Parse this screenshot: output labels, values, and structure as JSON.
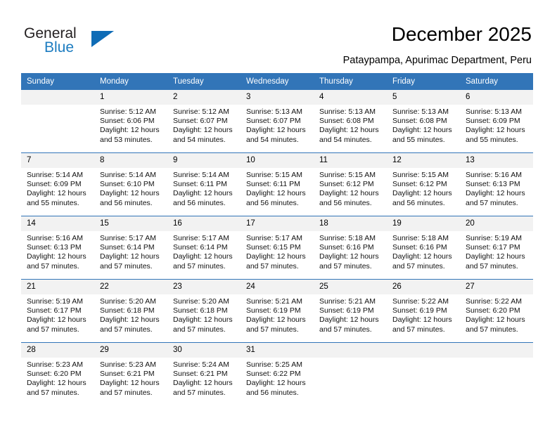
{
  "brand": {
    "line1": "General",
    "line2": "Blue",
    "triangle_icon": "brand-triangle-icon",
    "accent_color": "#0f6cb6"
  },
  "header": {
    "title": "December 2025",
    "subtitle": "Pataypampa, Apurimac Department, Peru"
  },
  "theme": {
    "header_blue": "#3275b8",
    "date_band_gray": "#f2f2f2",
    "rule_blue": "#3275b8",
    "text_black": "#000000"
  },
  "weekday_headers": [
    "Sunday",
    "Monday",
    "Tuesday",
    "Wednesday",
    "Thursday",
    "Friday",
    "Saturday"
  ],
  "weeks": [
    {
      "days": [
        {
          "date": "",
          "empty": true,
          "sunrise": "",
          "sunset": "",
          "daylight1": "",
          "daylight2": ""
        },
        {
          "date": "1",
          "empty": false,
          "sunrise": "Sunrise: 5:12 AM",
          "sunset": "Sunset: 6:06 PM",
          "daylight1": "Daylight: 12 hours",
          "daylight2": "and 53 minutes."
        },
        {
          "date": "2",
          "empty": false,
          "sunrise": "Sunrise: 5:12 AM",
          "sunset": "Sunset: 6:07 PM",
          "daylight1": "Daylight: 12 hours",
          "daylight2": "and 54 minutes."
        },
        {
          "date": "3",
          "empty": false,
          "sunrise": "Sunrise: 5:13 AM",
          "sunset": "Sunset: 6:07 PM",
          "daylight1": "Daylight: 12 hours",
          "daylight2": "and 54 minutes."
        },
        {
          "date": "4",
          "empty": false,
          "sunrise": "Sunrise: 5:13 AM",
          "sunset": "Sunset: 6:08 PM",
          "daylight1": "Daylight: 12 hours",
          "daylight2": "and 54 minutes."
        },
        {
          "date": "5",
          "empty": false,
          "sunrise": "Sunrise: 5:13 AM",
          "sunset": "Sunset: 6:08 PM",
          "daylight1": "Daylight: 12 hours",
          "daylight2": "and 55 minutes."
        },
        {
          "date": "6",
          "empty": false,
          "sunrise": "Sunrise: 5:13 AM",
          "sunset": "Sunset: 6:09 PM",
          "daylight1": "Daylight: 12 hours",
          "daylight2": "and 55 minutes."
        }
      ]
    },
    {
      "days": [
        {
          "date": "7",
          "empty": false,
          "sunrise": "Sunrise: 5:14 AM",
          "sunset": "Sunset: 6:09 PM",
          "daylight1": "Daylight: 12 hours",
          "daylight2": "and 55 minutes."
        },
        {
          "date": "8",
          "empty": false,
          "sunrise": "Sunrise: 5:14 AM",
          "sunset": "Sunset: 6:10 PM",
          "daylight1": "Daylight: 12 hours",
          "daylight2": "and 56 minutes."
        },
        {
          "date": "9",
          "empty": false,
          "sunrise": "Sunrise: 5:14 AM",
          "sunset": "Sunset: 6:11 PM",
          "daylight1": "Daylight: 12 hours",
          "daylight2": "and 56 minutes."
        },
        {
          "date": "10",
          "empty": false,
          "sunrise": "Sunrise: 5:15 AM",
          "sunset": "Sunset: 6:11 PM",
          "daylight1": "Daylight: 12 hours",
          "daylight2": "and 56 minutes."
        },
        {
          "date": "11",
          "empty": false,
          "sunrise": "Sunrise: 5:15 AM",
          "sunset": "Sunset: 6:12 PM",
          "daylight1": "Daylight: 12 hours",
          "daylight2": "and 56 minutes."
        },
        {
          "date": "12",
          "empty": false,
          "sunrise": "Sunrise: 5:15 AM",
          "sunset": "Sunset: 6:12 PM",
          "daylight1": "Daylight: 12 hours",
          "daylight2": "and 56 minutes."
        },
        {
          "date": "13",
          "empty": false,
          "sunrise": "Sunrise: 5:16 AM",
          "sunset": "Sunset: 6:13 PM",
          "daylight1": "Daylight: 12 hours",
          "daylight2": "and 57 minutes."
        }
      ]
    },
    {
      "days": [
        {
          "date": "14",
          "empty": false,
          "sunrise": "Sunrise: 5:16 AM",
          "sunset": "Sunset: 6:13 PM",
          "daylight1": "Daylight: 12 hours",
          "daylight2": "and 57 minutes."
        },
        {
          "date": "15",
          "empty": false,
          "sunrise": "Sunrise: 5:17 AM",
          "sunset": "Sunset: 6:14 PM",
          "daylight1": "Daylight: 12 hours",
          "daylight2": "and 57 minutes."
        },
        {
          "date": "16",
          "empty": false,
          "sunrise": "Sunrise: 5:17 AM",
          "sunset": "Sunset: 6:14 PM",
          "daylight1": "Daylight: 12 hours",
          "daylight2": "and 57 minutes."
        },
        {
          "date": "17",
          "empty": false,
          "sunrise": "Sunrise: 5:17 AM",
          "sunset": "Sunset: 6:15 PM",
          "daylight1": "Daylight: 12 hours",
          "daylight2": "and 57 minutes."
        },
        {
          "date": "18",
          "empty": false,
          "sunrise": "Sunrise: 5:18 AM",
          "sunset": "Sunset: 6:16 PM",
          "daylight1": "Daylight: 12 hours",
          "daylight2": "and 57 minutes."
        },
        {
          "date": "19",
          "empty": false,
          "sunrise": "Sunrise: 5:18 AM",
          "sunset": "Sunset: 6:16 PM",
          "daylight1": "Daylight: 12 hours",
          "daylight2": "and 57 minutes."
        },
        {
          "date": "20",
          "empty": false,
          "sunrise": "Sunrise: 5:19 AM",
          "sunset": "Sunset: 6:17 PM",
          "daylight1": "Daylight: 12 hours",
          "daylight2": "and 57 minutes."
        }
      ]
    },
    {
      "days": [
        {
          "date": "21",
          "empty": false,
          "sunrise": "Sunrise: 5:19 AM",
          "sunset": "Sunset: 6:17 PM",
          "daylight1": "Daylight: 12 hours",
          "daylight2": "and 57 minutes."
        },
        {
          "date": "22",
          "empty": false,
          "sunrise": "Sunrise: 5:20 AM",
          "sunset": "Sunset: 6:18 PM",
          "daylight1": "Daylight: 12 hours",
          "daylight2": "and 57 minutes."
        },
        {
          "date": "23",
          "empty": false,
          "sunrise": "Sunrise: 5:20 AM",
          "sunset": "Sunset: 6:18 PM",
          "daylight1": "Daylight: 12 hours",
          "daylight2": "and 57 minutes."
        },
        {
          "date": "24",
          "empty": false,
          "sunrise": "Sunrise: 5:21 AM",
          "sunset": "Sunset: 6:19 PM",
          "daylight1": "Daylight: 12 hours",
          "daylight2": "and 57 minutes."
        },
        {
          "date": "25",
          "empty": false,
          "sunrise": "Sunrise: 5:21 AM",
          "sunset": "Sunset: 6:19 PM",
          "daylight1": "Daylight: 12 hours",
          "daylight2": "and 57 minutes."
        },
        {
          "date": "26",
          "empty": false,
          "sunrise": "Sunrise: 5:22 AM",
          "sunset": "Sunset: 6:19 PM",
          "daylight1": "Daylight: 12 hours",
          "daylight2": "and 57 minutes."
        },
        {
          "date": "27",
          "empty": false,
          "sunrise": "Sunrise: 5:22 AM",
          "sunset": "Sunset: 6:20 PM",
          "daylight1": "Daylight: 12 hours",
          "daylight2": "and 57 minutes."
        }
      ]
    },
    {
      "days": [
        {
          "date": "28",
          "empty": false,
          "sunrise": "Sunrise: 5:23 AM",
          "sunset": "Sunset: 6:20 PM",
          "daylight1": "Daylight: 12 hours",
          "daylight2": "and 57 minutes."
        },
        {
          "date": "29",
          "empty": false,
          "sunrise": "Sunrise: 5:23 AM",
          "sunset": "Sunset: 6:21 PM",
          "daylight1": "Daylight: 12 hours",
          "daylight2": "and 57 minutes."
        },
        {
          "date": "30",
          "empty": false,
          "sunrise": "Sunrise: 5:24 AM",
          "sunset": "Sunset: 6:21 PM",
          "daylight1": "Daylight: 12 hours",
          "daylight2": "and 57 minutes."
        },
        {
          "date": "31",
          "empty": false,
          "sunrise": "Sunrise: 5:25 AM",
          "sunset": "Sunset: 6:22 PM",
          "daylight1": "Daylight: 12 hours",
          "daylight2": "and 56 minutes."
        },
        {
          "date": "",
          "empty": true,
          "sunrise": "",
          "sunset": "",
          "daylight1": "",
          "daylight2": ""
        },
        {
          "date": "",
          "empty": true,
          "sunrise": "",
          "sunset": "",
          "daylight1": "",
          "daylight2": ""
        },
        {
          "date": "",
          "empty": true,
          "sunrise": "",
          "sunset": "",
          "daylight1": "",
          "daylight2": ""
        }
      ]
    }
  ]
}
